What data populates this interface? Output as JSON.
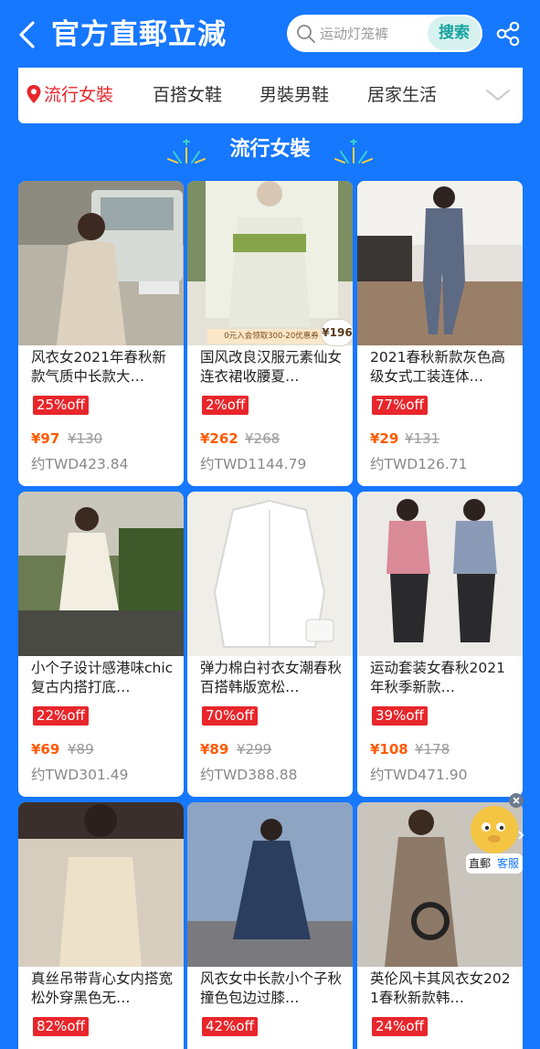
{
  "header": {
    "title": "官方直郵立減",
    "search_placeholder": "运动灯笼裤",
    "search_button": "搜索"
  },
  "tabs": [
    {
      "label": "流行女裝",
      "active": true
    },
    {
      "label": "百搭女鞋",
      "active": false
    },
    {
      "label": "男裝男鞋",
      "active": false
    },
    {
      "label": "居家生活",
      "active": false
    }
  ],
  "section": {
    "title": "流行女裝"
  },
  "products": [
    {
      "title": "风衣女2021年春秋新款气质中长款大…",
      "discount": "25%off",
      "price": "¥97",
      "orig": "¥130",
      "twd": "约TWD423.84"
    },
    {
      "title": "国风改良汉服元素仙女连衣裙收腰夏…",
      "discount": "2%off",
      "price": "¥262",
      "orig": "¥268",
      "twd": "约TWD1144.79",
      "img_text": "0元入会领取300-20优惠券",
      "img_badge": "¥196"
    },
    {
      "title": "2021春秋新款灰色高级女式工装连体…",
      "discount": "77%off",
      "price": "¥29",
      "orig": "¥131",
      "twd": "约TWD126.71"
    },
    {
      "title": "小个子设计感港味chic复古内搭打底…",
      "discount": "22%off",
      "price": "¥69",
      "orig": "¥89",
      "twd": "约TWD301.49"
    },
    {
      "title": "弹力棉白衬衣女潮春秋百搭韩版宽松…",
      "discount": "70%off",
      "price": "¥89",
      "orig": "¥299",
      "twd": "约TWD388.88"
    },
    {
      "title": "运动套装女春秋2021年秋季新款…",
      "discount": "39%off",
      "price": "¥108",
      "orig": "¥178",
      "twd": "约TWD471.90"
    },
    {
      "title": "真丝吊带背心女内搭宽松外穿黑色无…",
      "discount": "82%off",
      "price": "",
      "orig": "",
      "twd": ""
    },
    {
      "title": "风衣女中长款小个子秋撞色包边过膝…",
      "discount": "42%off",
      "price": "",
      "orig": "",
      "twd": ""
    },
    {
      "title": "英伦风卡其风衣女2021春秋新款韩…",
      "discount": "24%off",
      "price": "",
      "orig": "",
      "twd": ""
    }
  ],
  "helper": {
    "left_label": "直郵",
    "right_label": "客服"
  },
  "colors": {
    "brand_blue": "#1677ff",
    "discount_red": "#e8262b",
    "price_orange": "#ff5a00"
  }
}
